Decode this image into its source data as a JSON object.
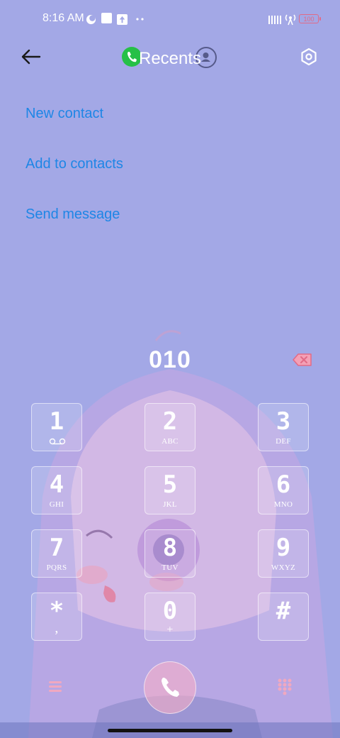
{
  "status_bar": {
    "time": "8:16 AM",
    "battery": "100",
    "icons": [
      "moon-icon",
      "app-notification-icon",
      "upload-icon",
      "more-dots-icon",
      "signal-icon",
      "hotspot-icon",
      "battery-icon"
    ]
  },
  "header": {
    "title": "Recents",
    "back_icon": "arrow-left-icon",
    "settings_icon": "settings-hexagon-icon"
  },
  "menu": {
    "items": [
      {
        "label": "New contact"
      },
      {
        "label": "Add to contacts"
      },
      {
        "label": "Send message"
      }
    ]
  },
  "dialer": {
    "number": "010",
    "keys": [
      {
        "digit": "1",
        "letters": ""
      },
      {
        "digit": "2",
        "letters": "ABC"
      },
      {
        "digit": "3",
        "letters": "DEF"
      },
      {
        "digit": "4",
        "letters": "GHI"
      },
      {
        "digit": "5",
        "letters": "JKL"
      },
      {
        "digit": "6",
        "letters": "MNO"
      },
      {
        "digit": "7",
        "letters": "PQRS"
      },
      {
        "digit": "8",
        "letters": "TUV"
      },
      {
        "digit": "9",
        "letters": "WXYZ"
      },
      {
        "digit": "*",
        "letters": ","
      },
      {
        "digit": "0",
        "letters": "+"
      },
      {
        "digit": "#",
        "letters": ""
      }
    ]
  },
  "colors": {
    "background": "#a3a8e6",
    "link": "#1e86e6",
    "accent_green": "#26c047",
    "accent_pink": "#e26a86"
  }
}
